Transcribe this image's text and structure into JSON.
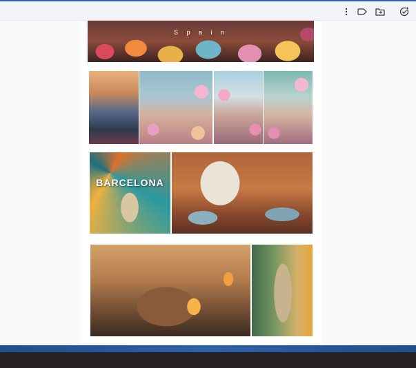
{
  "toolbar": {
    "icons": [
      "more-vertical-icon",
      "label-icon",
      "folder-move-icon",
      "task-check-icon"
    ]
  },
  "gallery": {
    "banner_caption": "S p a i n",
    "barcelona_label": "BARCELONA"
  },
  "colors": {
    "window_border": "#2f5fa8",
    "toolbar_bg": "#f2f4f8",
    "taskbar": "#272324"
  }
}
